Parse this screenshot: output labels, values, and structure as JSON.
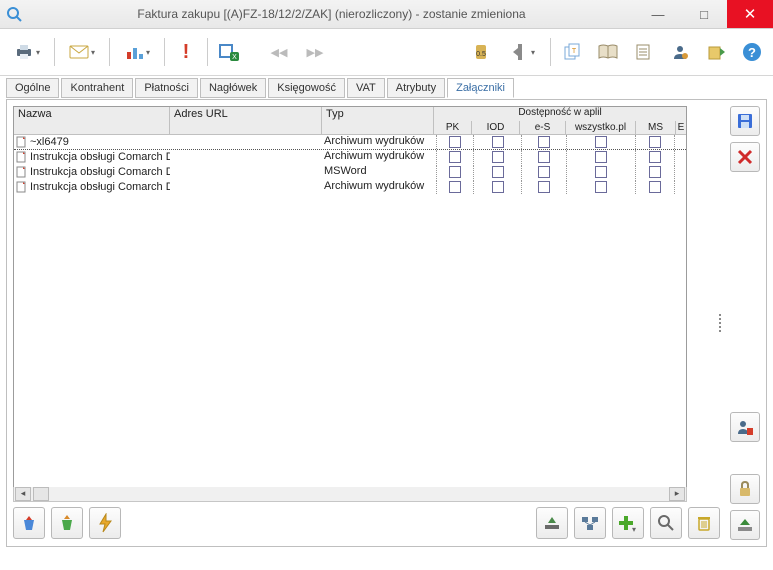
{
  "window": {
    "title": "Faktura zakupu [(A)FZ-18/12/2/ZAK] (nierozliczony) - zostanie zmieniona"
  },
  "toolbar": {
    "print": "print-icon",
    "mail": "mail-icon",
    "chart": "chart-icon",
    "alert": "alert-icon",
    "excel": "excel-icon",
    "prev": "◀◀",
    "next": "▶▶",
    "dim": "dim-icon",
    "split": "split-icon",
    "pages": "pages-icon",
    "book": "book-icon",
    "notes": "notes-icon",
    "user": "user-icon",
    "export": "export-icon",
    "help": "help-icon"
  },
  "tabs": [
    "Ogólne",
    "Kontrahent",
    "Płatności",
    "Nagłówek",
    "Księgowość",
    "VAT",
    "Atrybuty",
    "Załączniki"
  ],
  "active_tab": 7,
  "grid": {
    "group_header": "Dostępność w aplil",
    "cols": {
      "nazwa": "Nazwa",
      "url": "Adres URL",
      "typ": "Typ"
    },
    "sub": {
      "pk": "PK",
      "iod": "IOD",
      "es": "e-S",
      "wsz": "wszystko.pl",
      "ms": "MS",
      "e": "E"
    },
    "rows": [
      {
        "nazwa": "~xl6479",
        "url": "",
        "typ": "Archiwum wydruków"
      },
      {
        "nazwa": "Instrukcja obsługi Comarch D",
        "url": "",
        "typ": "Archiwum wydruków"
      },
      {
        "nazwa": "Instrukcja obsługi Comarch D",
        "url": "",
        "typ": "MSWord"
      },
      {
        "nazwa": "Instrukcja obsługi Comarch D",
        "url": "",
        "typ": "Archiwum wydruków"
      }
    ]
  },
  "side": {
    "save": "save-icon",
    "delete": "delete-icon",
    "user_settings": "user-settings-icon",
    "lock": "lock-icon",
    "eject": "eject-icon"
  },
  "bottom": {
    "bucket_in": "bucket-in-icon",
    "bucket_out": "bucket-out-icon",
    "bolt": "bolt-icon",
    "upload": "upload-icon",
    "network": "network-icon",
    "add": "add-icon",
    "search": "search-icon",
    "trash": "trash-icon"
  }
}
